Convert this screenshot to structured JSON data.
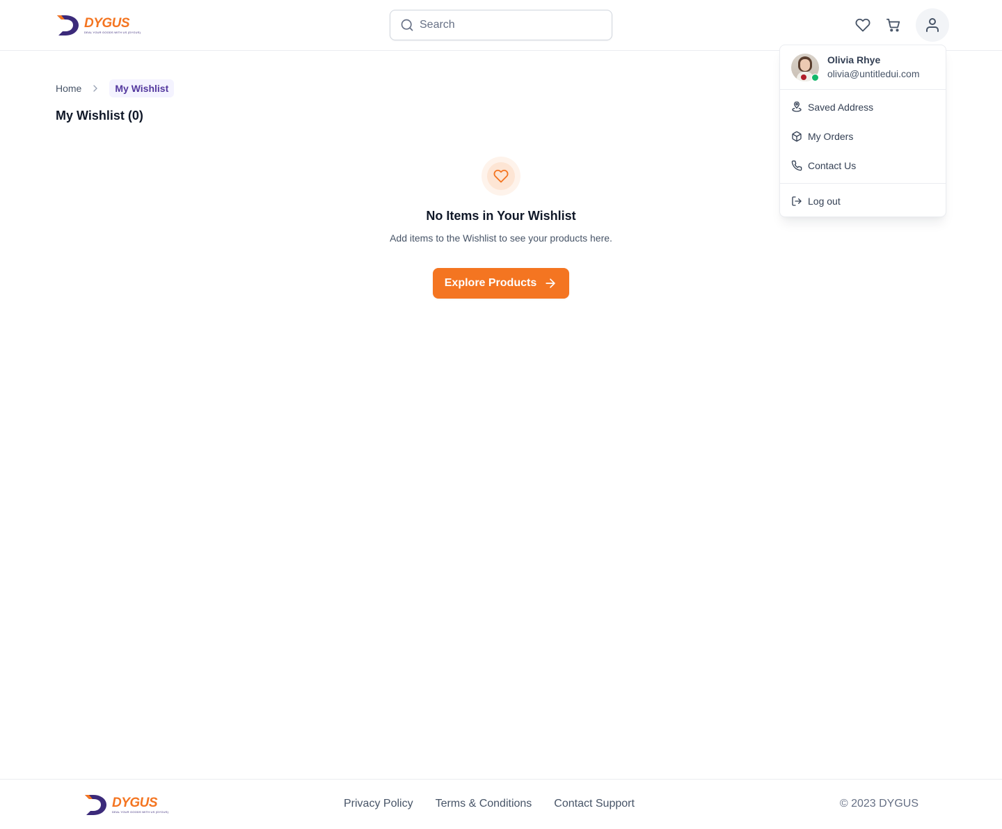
{
  "brand": {
    "name": "DYGUS",
    "tagline": "DEAL YOUR GOODS WITH US (DYGUS)",
    "primary_color": "#f47521",
    "secondary_color": "#3b2a7a"
  },
  "header": {
    "search_placeholder": "Search",
    "icons": [
      "heart-icon",
      "cart-icon",
      "user-icon"
    ]
  },
  "breadcrumb": {
    "home": "Home",
    "current": "My Wishlist"
  },
  "page": {
    "title": "My Wishlist (0)"
  },
  "empty_state": {
    "icon": "heart-icon",
    "title": "No Items in Your Wishlist",
    "subtitle": "Add items to the Wishlist to see your products here.",
    "button_label": "Explore Products"
  },
  "user_menu": {
    "name": "Olivia Rhye",
    "email": "olivia@untitledui.com",
    "status": "online",
    "items": [
      {
        "label": "Saved Address",
        "icon": "location-icon"
      },
      {
        "label": "My Orders",
        "icon": "package-icon"
      },
      {
        "label": "Contact Us",
        "icon": "phone-icon"
      }
    ],
    "logout_label": "Log out"
  },
  "footer": {
    "links": [
      "Privacy Policy",
      "Terms & Conditions",
      "Contact Support"
    ],
    "copyright": "© 2023 DYGUS"
  }
}
